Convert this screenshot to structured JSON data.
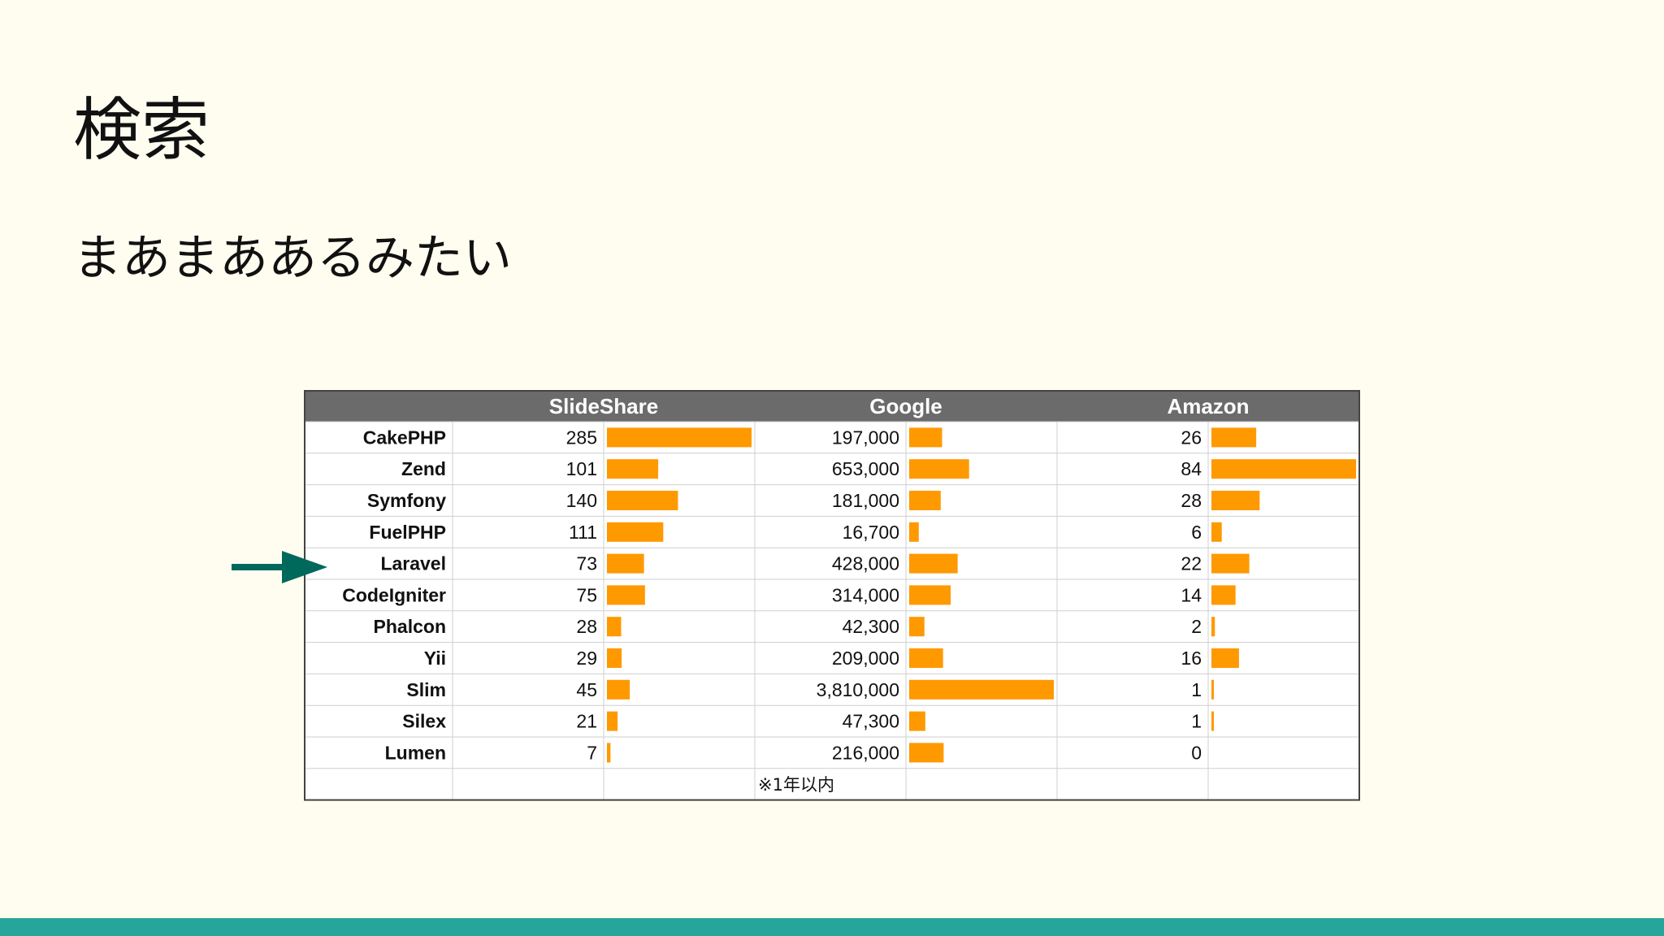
{
  "slide": {
    "title": "検索",
    "subtitle": "まあまああるみたい"
  },
  "colors": {
    "background": "#fefdf0",
    "header_bg": "#6b6b6b",
    "bar": "#ff9900",
    "arrow": "#00695c",
    "accent_bar": "#26a69a"
  },
  "icons": {
    "arrow": "right-arrow-icon"
  },
  "chart_data": {
    "type": "table",
    "columns": [
      "SlideShare",
      "Google",
      "Amazon"
    ],
    "rows": [
      {
        "name": "CakePHP",
        "values": [
          285,
          197000,
          26
        ]
      },
      {
        "name": "Zend",
        "values": [
          101,
          653000,
          84
        ]
      },
      {
        "name": "Symfony",
        "values": [
          140,
          181000,
          28
        ]
      },
      {
        "name": "FuelPHP",
        "values": [
          111,
          16700,
          6
        ]
      },
      {
        "name": "Laravel",
        "values": [
          73,
          428000,
          22
        ]
      },
      {
        "name": "CodeIgniter",
        "values": [
          75,
          314000,
          14
        ]
      },
      {
        "name": "Phalcon",
        "values": [
          28,
          42300,
          2
        ]
      },
      {
        "name": "Yii",
        "values": [
          29,
          209000,
          16
        ]
      },
      {
        "name": "Slim",
        "values": [
          45,
          3810000,
          1
        ]
      },
      {
        "name": "Silex",
        "values": [
          21,
          47300,
          1
        ]
      },
      {
        "name": "Lumen",
        "values": [
          7,
          216000,
          0
        ]
      }
    ],
    "display_values": [
      [
        "285",
        "197,000",
        "26"
      ],
      [
        "101",
        "653,000",
        "84"
      ],
      [
        "140",
        "181,000",
        "28"
      ],
      [
        "111",
        "16,700",
        "6"
      ],
      [
        "73",
        "428,000",
        "22"
      ],
      [
        "75",
        "314,000",
        "14"
      ],
      [
        "28",
        "42,300",
        "2"
      ],
      [
        "29",
        "209,000",
        "16"
      ],
      [
        "45",
        "3,810,000",
        "1"
      ],
      [
        "21",
        "47,300",
        "1"
      ],
      [
        "7",
        "216,000",
        "0"
      ]
    ],
    "bar_max": [
      285,
      653000,
      84
    ],
    "google_bar_scale": "sqrt",
    "highlight_row": "Laravel",
    "note": "※1年以内"
  }
}
